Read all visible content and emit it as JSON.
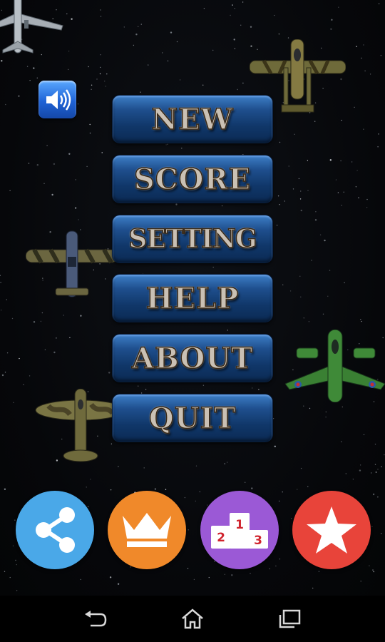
{
  "colors": {
    "share": "#4aa8e8",
    "crown": "#f0892a",
    "leaderboard": "#9b59d6",
    "rate": "#e8443a",
    "button_text": "#c9c0b4"
  },
  "sound_button": {
    "icon": "speaker-volume-icon"
  },
  "menu": {
    "items": [
      {
        "id": "new",
        "label": "NEW"
      },
      {
        "id": "score",
        "label": "SCORE"
      },
      {
        "id": "setting",
        "label": "SETTING"
      },
      {
        "id": "help",
        "label": "HELP"
      },
      {
        "id": "about",
        "label": "ABOUT"
      },
      {
        "id": "quit",
        "label": "QUIT"
      }
    ]
  },
  "bottom_buttons": [
    {
      "id": "share",
      "icon": "share-icon"
    },
    {
      "id": "crown",
      "icon": "crown-icon"
    },
    {
      "id": "leaderboard",
      "icon": "podium-icon",
      "places": [
        "1",
        "2",
        "3"
      ]
    },
    {
      "id": "rate",
      "icon": "star-icon"
    }
  ],
  "navbar": {
    "icons": [
      "back-icon",
      "home-icon",
      "recent-apps-icon"
    ]
  }
}
